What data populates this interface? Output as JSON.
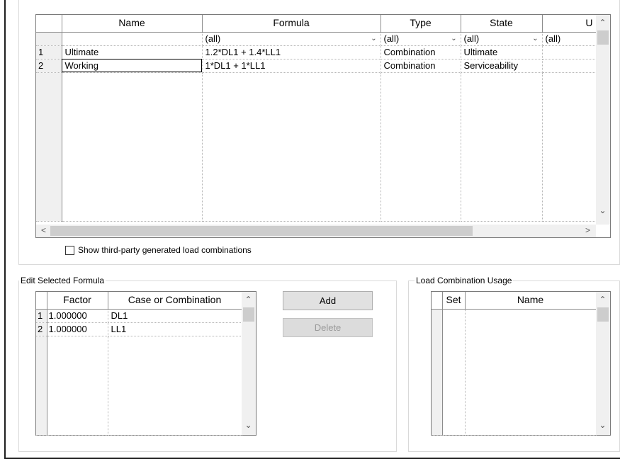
{
  "combo_grid": {
    "columns": [
      "Name",
      "Formula",
      "Type",
      "State",
      "U"
    ],
    "filters": [
      "(all)",
      "(all)",
      "(all)",
      "(all)"
    ],
    "rows": [
      {
        "num": "1",
        "name": "Ultimate",
        "formula": "1.2*DL1 + 1.4*LL1",
        "type": "Combination",
        "state": "Ultimate"
      },
      {
        "num": "2",
        "name": "Working",
        "formula": "1*DL1 + 1*LL1",
        "type": "Combination",
        "state": "Serviceability"
      }
    ]
  },
  "show_third_party": {
    "label": "Show third-party generated load combinations",
    "checked": false
  },
  "edit_formula": {
    "caption": "Edit Selected Formula",
    "columns": [
      "Factor",
      "Case or Combination"
    ],
    "rows": [
      {
        "num": "1",
        "factor": "1.000000",
        "case": "DL1"
      },
      {
        "num": "2",
        "factor": "1.000000",
        "case": "LL1"
      }
    ]
  },
  "buttons": {
    "add": "Add",
    "delete": "Delete"
  },
  "usage": {
    "caption": "Load Combination Usage",
    "columns": [
      "Set",
      "Name"
    ]
  },
  "icons": {
    "scroll_up": "chevron-up-icon",
    "scroll_down": "chevron-down-icon",
    "scroll_left": "chevron-left-icon",
    "scroll_right": "chevron-right-icon",
    "dropdown": "dropdown-arrow-icon"
  }
}
